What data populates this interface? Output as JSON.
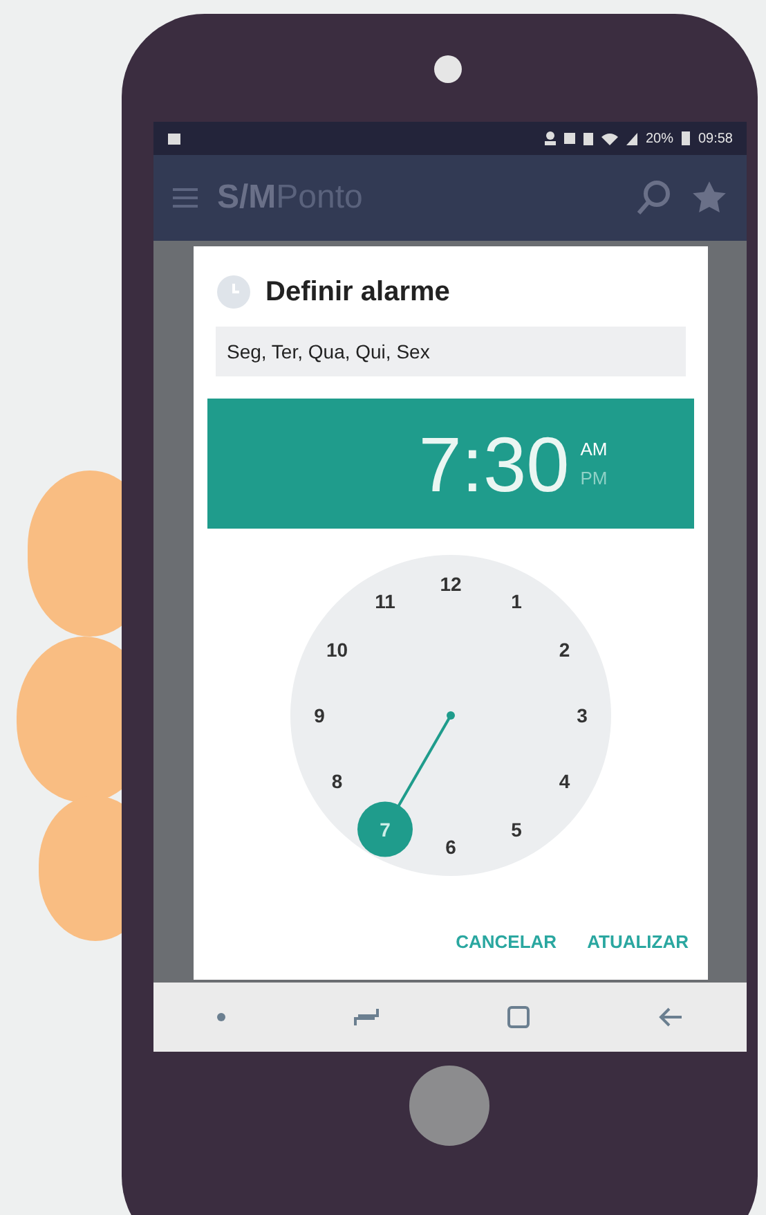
{
  "status_bar": {
    "battery": "20%",
    "time": "09:58"
  },
  "app_bar": {
    "logo_bold": "S/M",
    "logo_light": "Ponto"
  },
  "dialog": {
    "title": "Definir alarme",
    "days_field": {
      "value": "Seg, Ter, Qua, Qui, Sex"
    },
    "time": "7:30",
    "periods": [
      {
        "label": "AM",
        "selected": true
      },
      {
        "label": "PM",
        "selected": false
      }
    ],
    "clock_numbers": [
      {
        "label": "12",
        "selected": false
      },
      {
        "label": "1",
        "selected": false
      },
      {
        "label": "2",
        "selected": false
      },
      {
        "label": "3",
        "selected": false
      },
      {
        "label": "4",
        "selected": false
      },
      {
        "label": "5",
        "selected": false
      },
      {
        "label": "6",
        "selected": false
      },
      {
        "label": "7",
        "selected": true
      },
      {
        "label": "8",
        "selected": false
      },
      {
        "label": "9",
        "selected": false
      },
      {
        "label": "10",
        "selected": false
      },
      {
        "label": "11",
        "selected": false
      }
    ],
    "buttons": [
      "CANCELAR",
      "ATUALIZAR"
    ]
  }
}
